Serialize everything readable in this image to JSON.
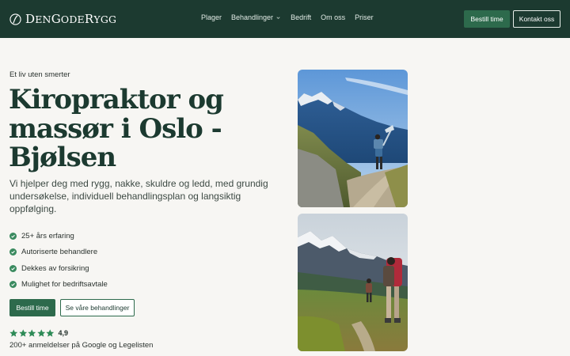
{
  "brand": {
    "name_parts": [
      {
        "cap": "D",
        "rest": "EN"
      },
      {
        "cap": "G",
        "rest": "ODE"
      },
      {
        "cap": "R",
        "rest": "YGG"
      }
    ],
    "logo_icon": "spine-leaf-icon"
  },
  "nav": {
    "links": [
      {
        "label": "Plager"
      },
      {
        "label": "Behandlinger",
        "has_dropdown": true
      },
      {
        "label": "Bedrift"
      },
      {
        "label": "Om oss"
      },
      {
        "label": "Priser"
      }
    ],
    "book_label": "Bestill time",
    "contact_label": "Kontakt oss"
  },
  "hero": {
    "eyebrow": "Et liv uten smerter",
    "title": "Kiropraktor og massør i Oslo - Bjølsen",
    "lead": "Vi hjelper deg med rygg, nakke, skuldre og ledd, med grundig undersøkelse, individuell behandlingsplan og langsiktig oppfølging.",
    "features": [
      "25+ års erfaring",
      "Autoriserte behandlere",
      "Dekkes av forsikring",
      "Mulighet for bedriftsavtale"
    ],
    "primary_cta": "Bestill time",
    "secondary_cta": "Se våre behandlinger",
    "rating": {
      "stars": 5,
      "value": "4,9",
      "reviews_text": "200+ anmeldelser på Google og Legelisten"
    }
  },
  "photos": [
    {
      "name": "hiker-mountain-trail-photo"
    },
    {
      "name": "two-hikers-mountain-photo"
    }
  ],
  "colors": {
    "nav_bg": "#1c3a30",
    "accent": "#2d6a4c",
    "heading": "#1c3a30",
    "page_bg": "#f7f6f3",
    "star": "#2e8b57",
    "check": "#3a8a5f"
  },
  "icons": {
    "check": "check-circle-icon",
    "star": "star-icon",
    "dropdown": "chevron-down-icon"
  }
}
